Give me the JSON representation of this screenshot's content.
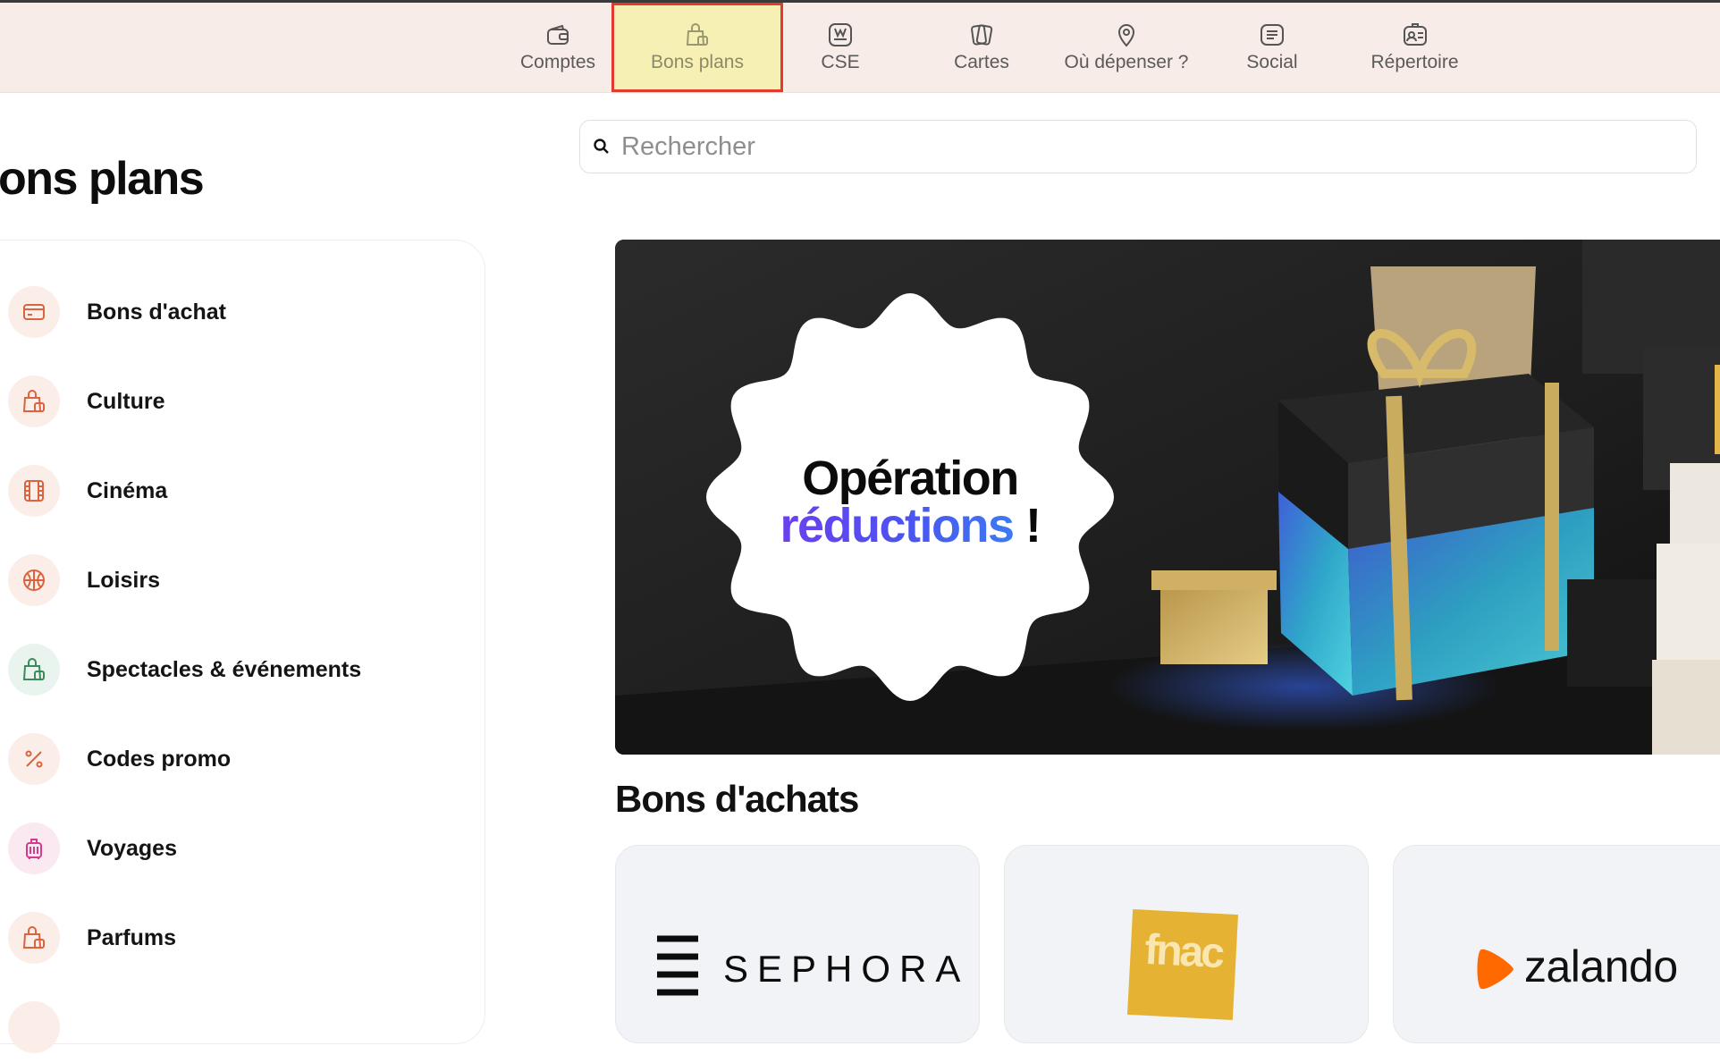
{
  "nav": {
    "items": [
      {
        "label": "Comptes",
        "icon": "wallet-icon"
      },
      {
        "label": "Bons plans",
        "icon": "shopping-bag-icon",
        "active": true
      },
      {
        "label": "CSE",
        "icon": "cse-icon"
      },
      {
        "label": "Cartes",
        "icon": "cards-icon"
      },
      {
        "label": "Où dépenser ?",
        "icon": "location-pin-icon"
      },
      {
        "label": "Social",
        "icon": "social-icon"
      },
      {
        "label": "Répertoire",
        "icon": "directory-icon"
      }
    ]
  },
  "page": {
    "title": "ons plans"
  },
  "search": {
    "placeholder": "Rechercher",
    "value": ""
  },
  "sidebar": {
    "items": [
      {
        "label": "Bons d'achat",
        "icon": "gift-card-icon",
        "color": "#d9643f",
        "bg": "#fbeee9"
      },
      {
        "label": "Culture",
        "icon": "shopping-bag-icon",
        "color": "#d9643f",
        "bg": "#fbeee9"
      },
      {
        "label": "Cinéma",
        "icon": "film-icon",
        "color": "#d9643f",
        "bg": "#fbeee9"
      },
      {
        "label": "Loisirs",
        "icon": "basketball-icon",
        "color": "#d9643f",
        "bg": "#fbeee9"
      },
      {
        "label": "Spectacles & événements",
        "icon": "shopping-bag-icon",
        "color": "#3a8a5a",
        "bg": "#eaf4ee"
      },
      {
        "label": "Codes promo",
        "icon": "percent-icon",
        "color": "#d9643f",
        "bg": "#fbeee9"
      },
      {
        "label": "Voyages",
        "icon": "suitcase-icon",
        "color": "#d63a8a",
        "bg": "#fbe9f2"
      },
      {
        "label": "Parfums",
        "icon": "shopping-bag-icon",
        "color": "#d9643f",
        "bg": "#fbeee9"
      }
    ]
  },
  "banner": {
    "line1": "Opération",
    "line2": "réductions",
    "line2_suffix": " !"
  },
  "section": {
    "title": "Bons d'achats"
  },
  "brands": [
    {
      "name": "SEPHORA"
    },
    {
      "name": "fnac"
    },
    {
      "name": "zalando"
    }
  ],
  "colors": {
    "nav_bg": "#f7ece7",
    "active_tab_bg": "#f6f0b4",
    "highlight_border": "#e23b2e",
    "accent_gradient_start": "#6b3ff0",
    "accent_gradient_end": "#3c7bf2",
    "fnac": "#e5b234",
    "zalando": "#ff6900"
  }
}
